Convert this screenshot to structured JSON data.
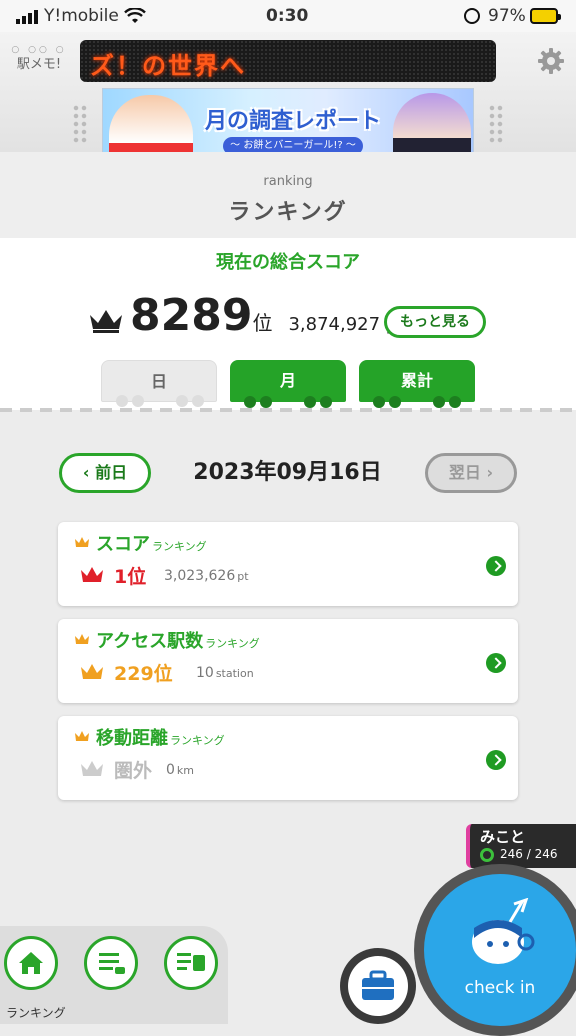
{
  "status_bar": {
    "carrier": "Y!mobile",
    "time": "0:30",
    "battery": "97%"
  },
  "header": {
    "logo": "駅メモ!",
    "ticker": "ズ！の世界へ",
    "banner_title": "月の調査レポート",
    "banner_subtitle": "～ お餅とバニーガール!? ～"
  },
  "page": {
    "title_en": "ranking",
    "title_ja": "ランキング"
  },
  "score": {
    "label": "現在の総合スコア",
    "rank": "8289",
    "rank_unit": "位",
    "points": "3,874,927 pt",
    "more_button": "もっと見る"
  },
  "tabs": [
    {
      "label": "日",
      "active": false
    },
    {
      "label": "月",
      "active": true
    },
    {
      "label": "累計",
      "active": true
    }
  ],
  "date_nav": {
    "prev": "前日",
    "date": "2023年09月16日",
    "next": "翌日"
  },
  "rankings": [
    {
      "title": "スコア",
      "suffix": "ランキング",
      "rank": "1位",
      "value": "3,023,626",
      "unit": "pt",
      "rank_color": "#e0202a",
      "crown_color": "#e0202a"
    },
    {
      "title": "アクセス駅数",
      "suffix": "ランキング",
      "rank": "229位",
      "value": "10",
      "unit": "station",
      "rank_color": "#f0a020",
      "crown_color": "#f0a020"
    },
    {
      "title": "移動距離",
      "suffix": "ランキング",
      "rank": "圏外",
      "value": "0",
      "unit": "km",
      "rank_color": "#bbbbbb",
      "crown_color": "#cccccc"
    }
  ],
  "user": {
    "name": "みこと",
    "hp": "246 / 246"
  },
  "bottom_nav": {
    "label": "ランキング"
  },
  "checkin": {
    "label": "check in"
  }
}
